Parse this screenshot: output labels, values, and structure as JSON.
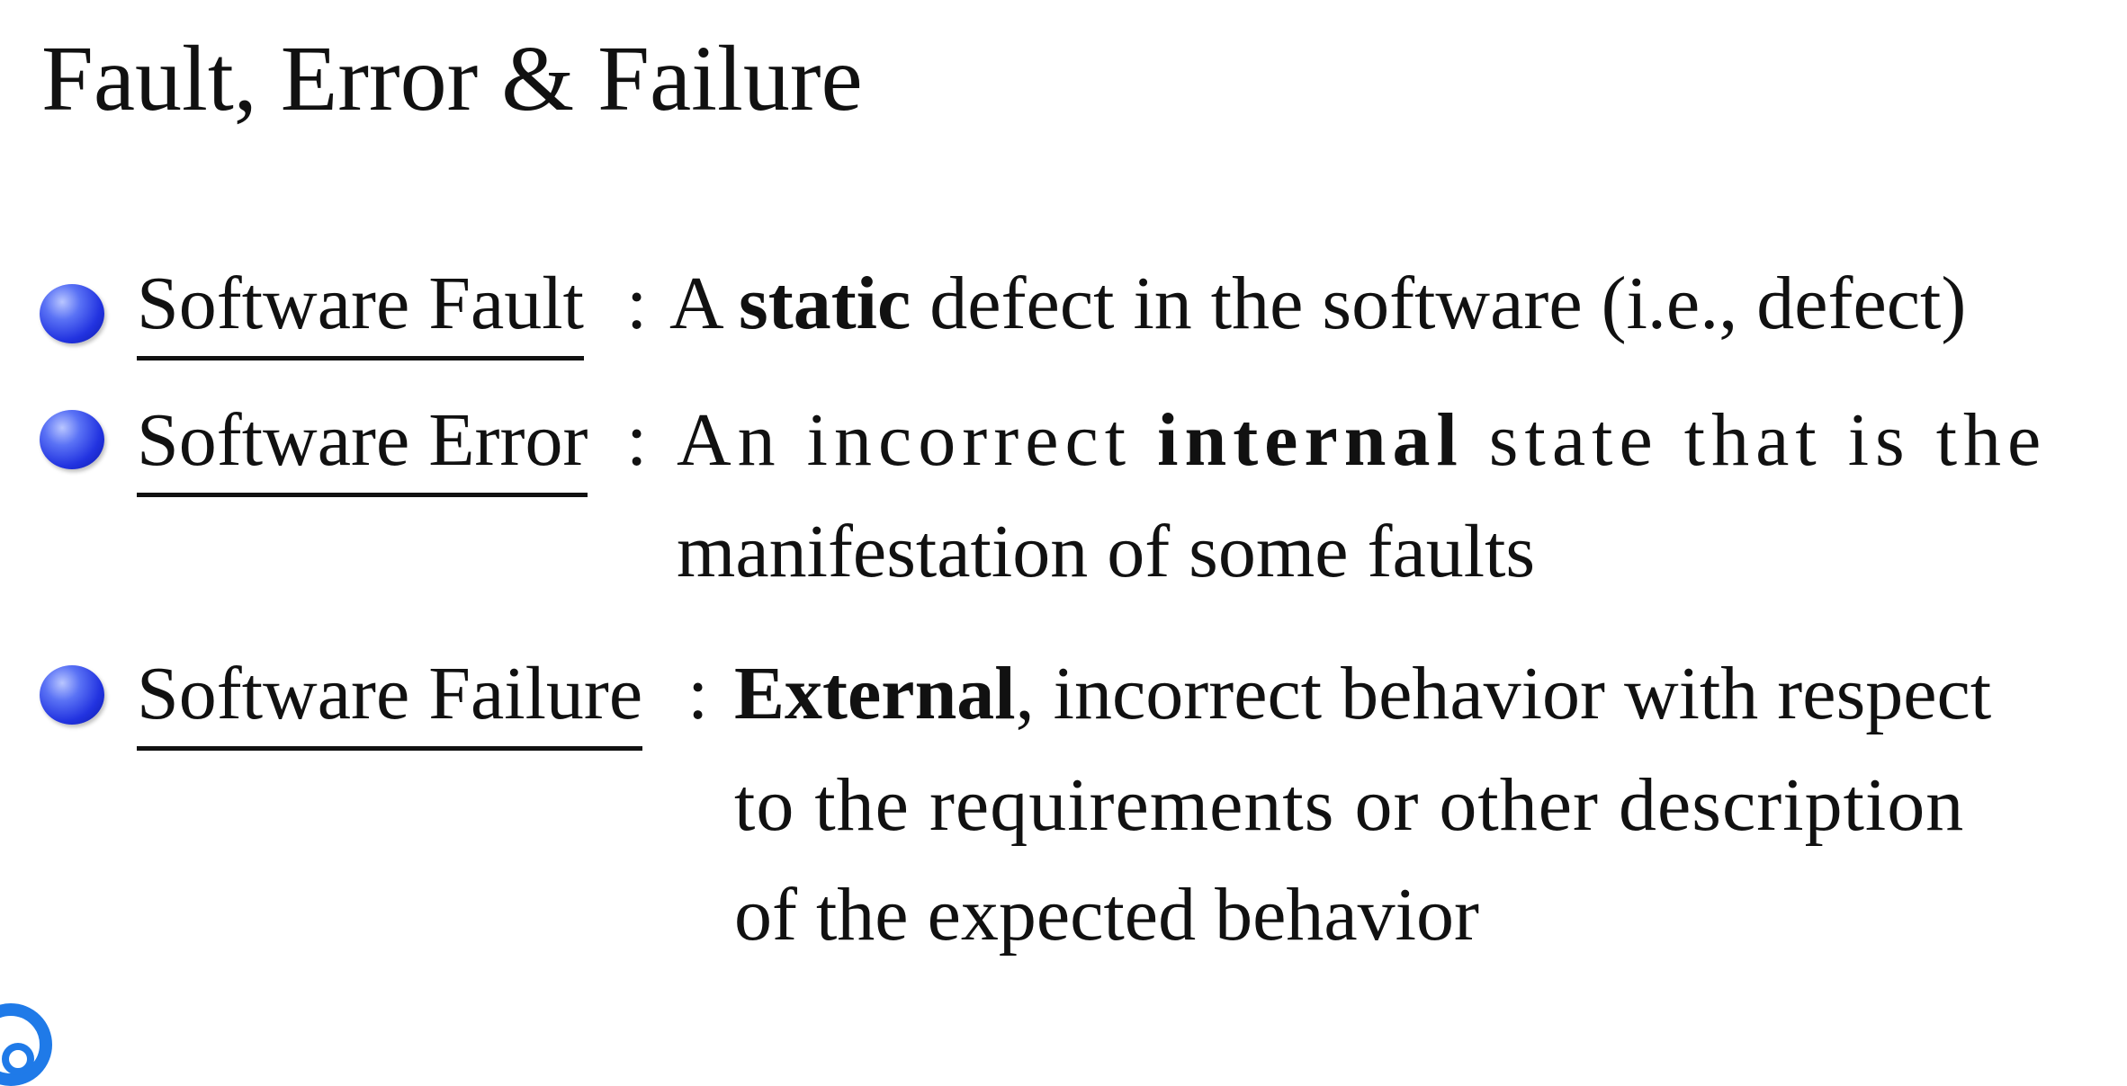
{
  "slide": {
    "title": "Fault, Error & Failure",
    "items": [
      {
        "term": "Software Fault",
        "colon": ":",
        "lines": [
          {
            "pre": "A ",
            "bold": "static",
            "post": " defect in the software (i.e., defect)"
          }
        ]
      },
      {
        "term": "Software Error",
        "colon": ":",
        "lines": [
          {
            "pre": "An incorrect ",
            "bold": "internal",
            "post": " state that is the"
          },
          {
            "pre": "manifestation of some faults",
            "bold": "",
            "post": ""
          }
        ]
      },
      {
        "term": "Software Failure",
        "colon": ":",
        "lines": [
          {
            "pre": "",
            "bold": "External",
            "post": ", incorrect behavior with respect"
          },
          {
            "pre": "to the requirements or other description",
            "bold": "",
            "post": ""
          },
          {
            "pre": "of the expected behavior",
            "bold": "",
            "post": ""
          }
        ]
      }
    ]
  },
  "colors": {
    "bullet": "#2233e0",
    "text": "#111111",
    "logo": "#1f7ae8"
  },
  "icons": {
    "bullet": "blue-sphere-bullet-icon",
    "logo": "app-logo-icon"
  }
}
